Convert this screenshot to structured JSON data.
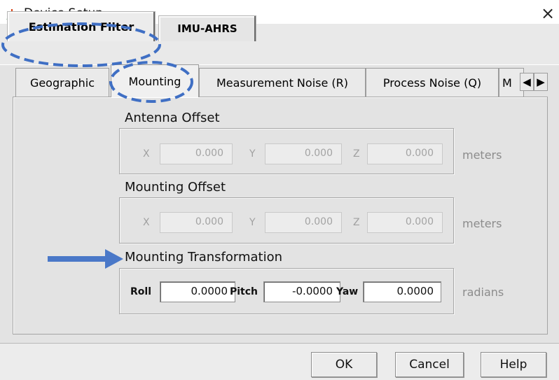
{
  "window": {
    "title": "Device Setup",
    "close_glyph": "×",
    "app_icon": "axes-icon"
  },
  "outer_tabs": [
    {
      "label": "Estimation Filter",
      "selected": true
    },
    {
      "label": "IMU-AHRS",
      "selected": false
    }
  ],
  "inner_tabs": [
    {
      "label": "Geographic",
      "selected": false
    },
    {
      "label": "Mounting",
      "selected": true
    },
    {
      "label": "Measurement Noise (R)",
      "selected": false
    },
    {
      "label": "Process Noise (Q)",
      "selected": false
    },
    {
      "label": "M",
      "selected": false
    }
  ],
  "tab_scroll": {
    "left_glyph": "◀",
    "right_glyph": "▶"
  },
  "antenna_offset": {
    "title": "Antenna Offset",
    "x_label": "X",
    "x_value": "0.000",
    "y_label": "Y",
    "y_value": "0.000",
    "z_label": "Z",
    "z_value": "0.000",
    "unit": "meters"
  },
  "mounting_offset": {
    "title": "Mounting Offset",
    "x_label": "X",
    "x_value": "0.000",
    "y_label": "Y",
    "y_value": "0.000",
    "z_label": "Z",
    "z_value": "0.000",
    "unit": "meters"
  },
  "mounting_transformation": {
    "title": "Mounting Transformation",
    "roll_label": "Roll",
    "roll_value": "0.0000",
    "pitch_label": "Pitch",
    "pitch_value": "-0.0000",
    "yaw_label": "Yaw",
    "yaw_value": "0.0000",
    "unit": "radians"
  },
  "buttons": {
    "ok": "OK",
    "cancel": "Cancel",
    "help": "Help"
  },
  "annotation_colors": {
    "highlight": "#3f6fc4"
  }
}
